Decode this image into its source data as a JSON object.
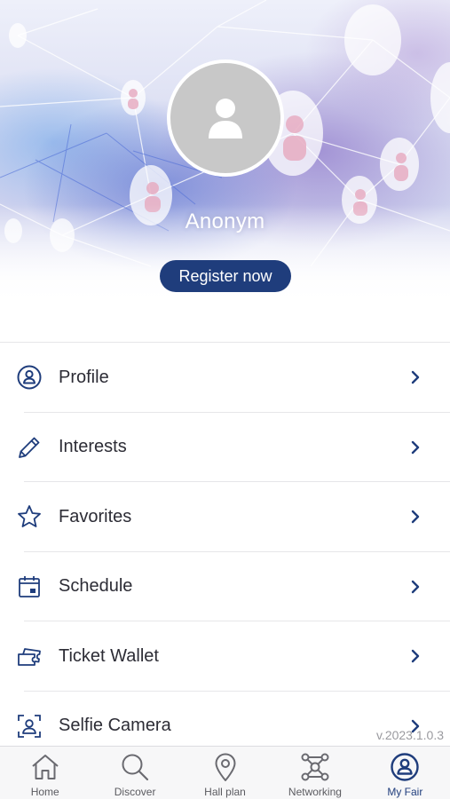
{
  "profile": {
    "name": "Anonym",
    "register_label": "Register now",
    "avatar_icon": "person-placeholder-icon"
  },
  "menu": {
    "items": [
      {
        "label": "Profile",
        "icon": "profile-icon"
      },
      {
        "label": "Interests",
        "icon": "pencil-icon"
      },
      {
        "label": "Favorites",
        "icon": "star-icon"
      },
      {
        "label": "Schedule",
        "icon": "calendar-icon"
      },
      {
        "label": "Ticket Wallet",
        "icon": "ticket-icon"
      },
      {
        "label": "Selfie Camera",
        "icon": "selfie-camera-icon"
      }
    ]
  },
  "version": "v.2023.1.0.3",
  "tabbar": {
    "tabs": [
      {
        "label": "Home",
        "icon": "home-icon",
        "active": false
      },
      {
        "label": "Discover",
        "icon": "search-icon",
        "active": false
      },
      {
        "label": "Hall plan",
        "icon": "map-pin-icon",
        "active": false
      },
      {
        "label": "Networking",
        "icon": "network-icon",
        "active": false
      },
      {
        "label": "My Fair",
        "icon": "user-circle-icon",
        "active": true
      }
    ]
  },
  "colors": {
    "accent": "#1f3d7c",
    "avatar_bg": "#c8c8c8",
    "text": "#2c2c35",
    "muted": "#9a9a9f",
    "divider": "#e6e6e9"
  }
}
